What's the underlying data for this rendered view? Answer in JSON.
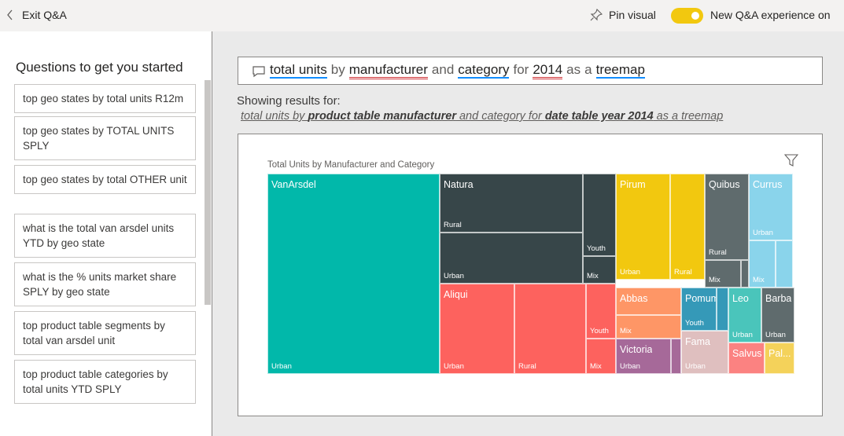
{
  "topbar": {
    "exit_label": "Exit Q&A",
    "pin_label": "Pin visual",
    "toggle_label": "New Q&A experience on",
    "toggle_on": true
  },
  "sidebar": {
    "title": "Questions to get you started",
    "questions": [
      "top geo states by total units R12m",
      "top geo states by TOTAL UNITS SPLY",
      "top geo states by total OTHER unit",
      "what is the total van arsdel units YTD by geo state",
      "what is the % units market share SPLY by geo state",
      "top product table segments by total van arsdel unit",
      "top product table categories by total units YTD SPLY"
    ]
  },
  "query": {
    "tokens": [
      "total units",
      "by",
      "manufacturer",
      "and",
      "category",
      "for",
      "2014",
      "as",
      "a",
      "treemap"
    ],
    "showing_label": "Showing results for:",
    "restated": {
      "p1": "total units by ",
      "b1": "product table manufacturer",
      "p2": " and category for ",
      "b2": "date table year 2014",
      "p3": " as a treemap"
    }
  },
  "chart": {
    "title": "Total Units by Manufacturer and Category",
    "colors": {
      "VanArsdel": "#01b8aa",
      "Natura": "#374649",
      "Aliqui": "#fd625e",
      "Pirum": "#f2c80f",
      "Quibus": "#5f6b6d",
      "Currus": "#8ad4eb",
      "Abbas": "#fe9666",
      "Victoria": "#a66999",
      "Pomum": "#3599b8",
      "Fama": "#dfbfbf",
      "Leo": "#4ac5bb",
      "Barba": "#5f6b6d",
      "Salvus": "#fb8281",
      "Palma": "#f4d25a"
    },
    "labels": {
      "VanArsdel": "VanArsdel",
      "Natura": "Natura",
      "Aliqui": "Aliqui",
      "Pirum": "Pirum",
      "Quibus": "Quibus",
      "Currus": "Currus",
      "Abbas": "Abbas",
      "Victoria": "Victoria",
      "Pomum": "Pomum",
      "Fama": "Fama",
      "Leo": "Leo",
      "Barba": "Barba",
      "Salvus": "Salvus",
      "Palma": "Pal..."
    },
    "categories": {
      "urban": "Urban",
      "rural": "Rural",
      "mix": "Mix",
      "youth": "Youth"
    }
  }
}
